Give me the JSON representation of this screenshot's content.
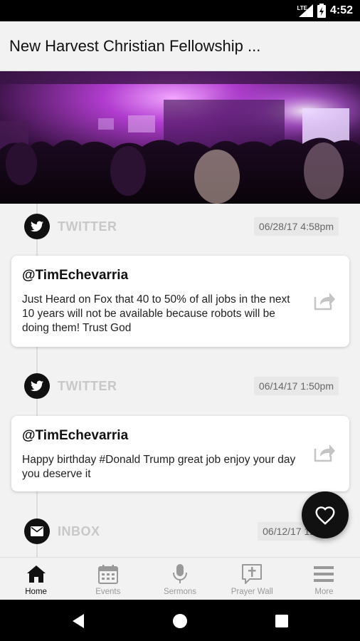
{
  "status_bar": {
    "network": "LTE",
    "time": "4:52"
  },
  "app_bar": {
    "title": "New Harvest Christian Fellowship ..."
  },
  "feed": {
    "entries": [
      {
        "type": "TWITTER",
        "date": "06/28/17 4:58pm",
        "user": "@TimEchevarria",
        "text": "Just Heard  on Fox that 40 to 50% of all jobs in the next 10 years will not be available because robots will be doing them! Trust God",
        "icon": "twitter-bird-icon"
      },
      {
        "type": "TWITTER",
        "date": "06/14/17 1:50pm",
        "user": "@TimEchevarria",
        "text": "Happy birthday #Donald Trump great job enjoy your day you deserve it",
        "icon": "twitter-bird-icon"
      },
      {
        "type": "INBOX",
        "date": "06/12/17 12:",
        "icon": "envelope-icon"
      }
    ]
  },
  "bottom_nav": {
    "items": [
      {
        "label": "Home",
        "icon": "home-icon",
        "active": true
      },
      {
        "label": "Events",
        "icon": "calendar-icon"
      },
      {
        "label": "Sermons",
        "icon": "microphone-icon"
      },
      {
        "label": "Prayer Wall",
        "icon": "prayer-wall-icon"
      },
      {
        "label": "More",
        "icon": "menu-icon"
      }
    ]
  },
  "colors": {
    "accent": "#111111",
    "background": "#f2f2f2",
    "label_muted": "#c8c8c8"
  }
}
